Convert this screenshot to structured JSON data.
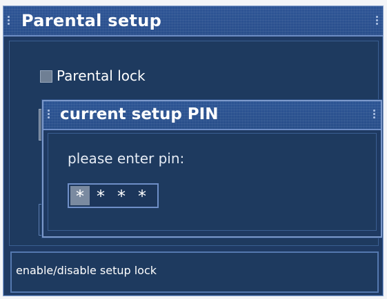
{
  "window": {
    "title": "Parental setup"
  },
  "options": {
    "parental_lock_label": "Parental lock",
    "parental_lock_checked": false
  },
  "dialog": {
    "title": "current setup PIN",
    "prompt": "please enter pin:",
    "pin_digits": [
      "*",
      "*",
      "*",
      "*"
    ],
    "active_digit_index": 0
  },
  "status": {
    "text": "enable/disable setup lock"
  },
  "colors": {
    "window_background": "#1f3a63",
    "titlebar": "#2e5596",
    "border": "#7c99cb",
    "text": "#ffffff",
    "active_cell": "#7a8aa0"
  }
}
